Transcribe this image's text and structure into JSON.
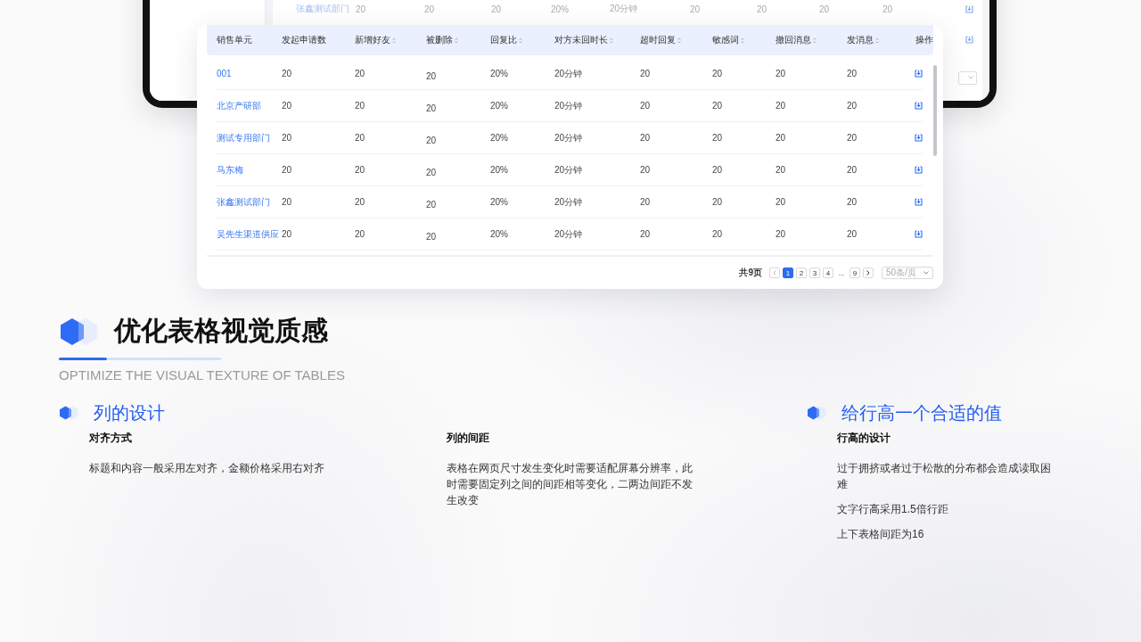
{
  "back_table": {
    "row": [
      "张鑫测试部门",
      "20",
      "20",
      "20",
      "20%",
      "20分钟",
      "20",
      "20",
      "20",
      "20"
    ]
  },
  "table": {
    "columns": [
      {
        "label": "销售单元",
        "sortable": false
      },
      {
        "label": "发起申请数",
        "sortable": false
      },
      {
        "label": "新增好友",
        "sortable": true
      },
      {
        "label": "被删除",
        "sortable": true
      },
      {
        "label": "回复比",
        "sortable": true
      },
      {
        "label": "对方未回时长",
        "sortable": true
      },
      {
        "label": "超时回复",
        "sortable": true
      },
      {
        "label": "敏感词",
        "sortable": true
      },
      {
        "label": "撤回消息",
        "sortable": true
      },
      {
        "label": "发消息",
        "sortable": true
      },
      {
        "label": "操作",
        "sortable": false
      }
    ],
    "rows": [
      [
        "001",
        "20",
        "20",
        "20",
        "20%",
        "20分钟",
        "20",
        "20",
        "20",
        "20"
      ],
      [
        "北京产研部",
        "20",
        "20",
        "20",
        "20%",
        "20分钟",
        "20",
        "20",
        "20",
        "20"
      ],
      [
        "测试专用部门",
        "20",
        "20",
        "20",
        "20%",
        "20分钟",
        "20",
        "20",
        "20",
        "20"
      ],
      [
        "马东梅",
        "20",
        "20",
        "20",
        "20%",
        "20分钟",
        "20",
        "20",
        "20",
        "20"
      ],
      [
        "张鑫测试部门",
        "20",
        "20",
        "20",
        "20%",
        "20分钟",
        "20",
        "20",
        "20",
        "20"
      ],
      [
        "吴先生渠道供应",
        "20",
        "20",
        "20",
        "20%",
        "20分钟",
        "20",
        "20",
        "20",
        "20"
      ]
    ],
    "pagination": {
      "total": "共9页",
      "pages": [
        {
          "label": "1",
          "selected": true
        },
        {
          "label": "2",
          "selected": false
        },
        {
          "label": "3",
          "selected": false
        },
        {
          "label": "4",
          "selected": false
        },
        {
          "label": "...",
          "selected": false
        },
        {
          "label": "9",
          "selected": false
        }
      ],
      "page_size": "50条/页"
    }
  },
  "heading": {
    "title": "优化表格视觉质感",
    "subtitle": "OPTIMIZE THE VISUAL TEXTURE OF TABLES"
  },
  "sections": [
    {
      "title": "列的设计",
      "subtitle": "对齐方式",
      "paragraphs": [
        "标题和内容一般采用左对齐，金额价格采用右对齐"
      ]
    },
    {
      "subtitle": "列的间距",
      "paragraphs": [
        "表格在网页尺寸发生变化时需要适配屏幕分辨率，此时需要固定列之间的间距相等变化，二两边间距不发生改变"
      ]
    },
    {
      "title": "给行高一个合适的值",
      "subtitle": "行高的设计",
      "paragraphs": [
        "过于拥挤或者过于松散的分布都会造成读取困难",
        "文字行高采用1.5倍行距",
        "上下表格间距为16"
      ]
    }
  ]
}
